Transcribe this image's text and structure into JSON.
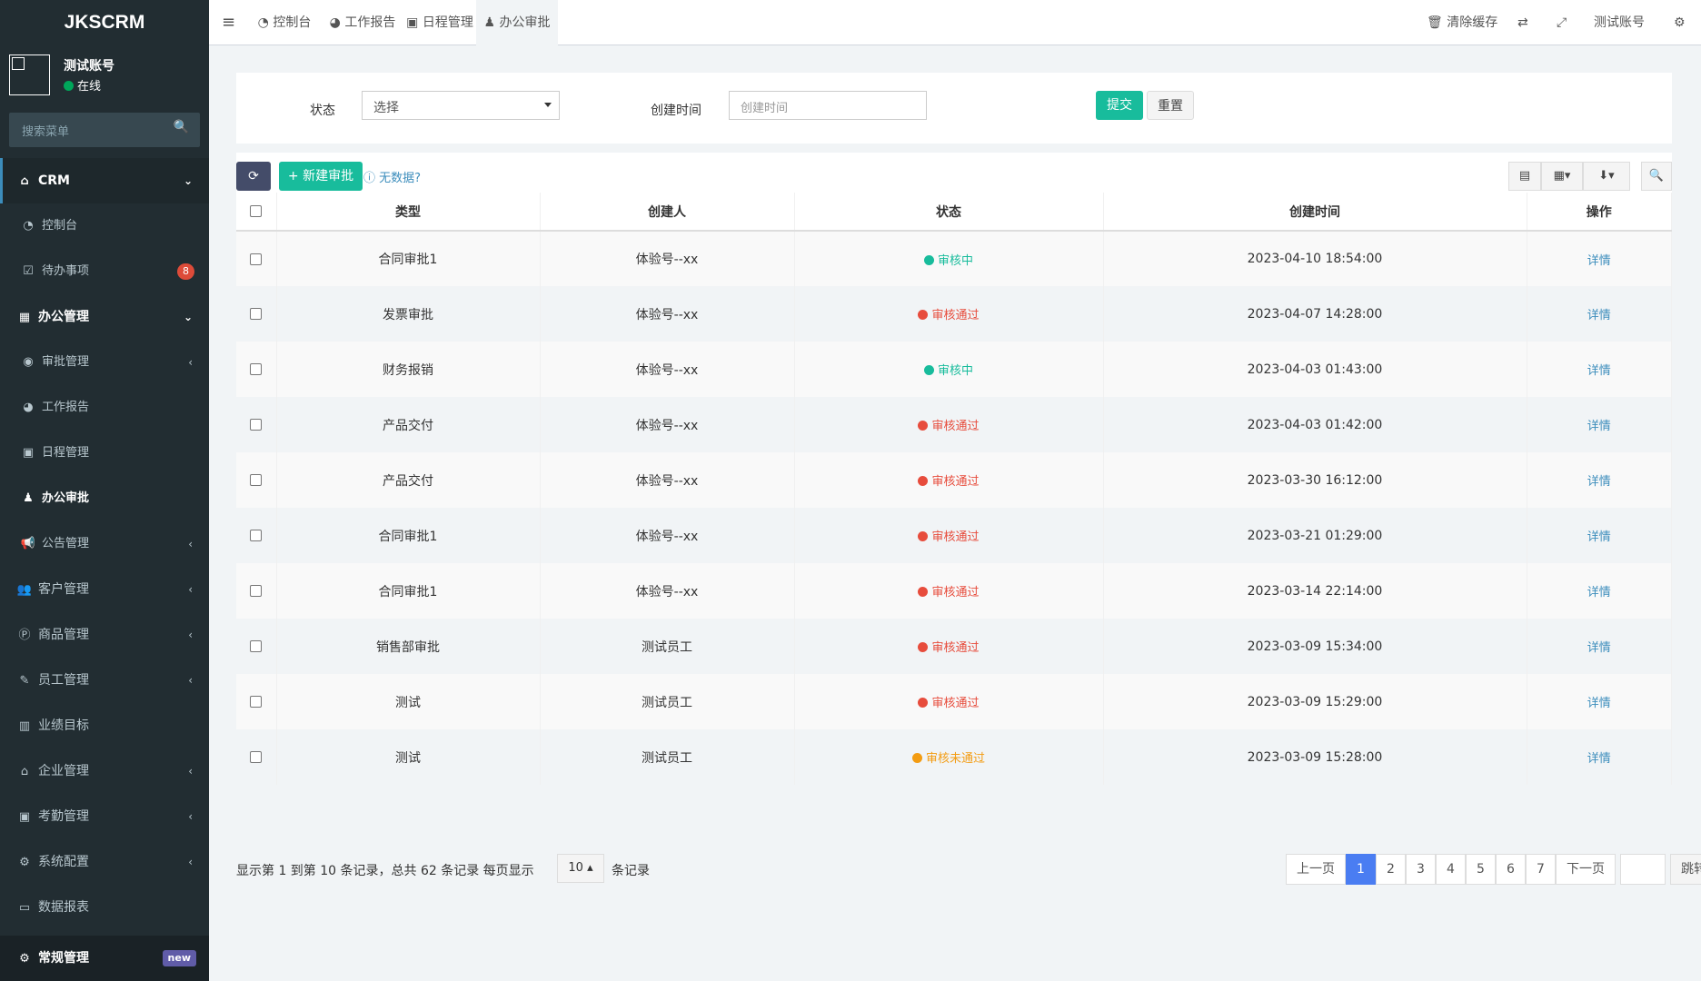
{
  "app": {
    "logo": "JKSCRM",
    "user_name": "测试账号",
    "user_status": "在线",
    "search_placeholder": "搜索菜单"
  },
  "menu": [
    {
      "label": "CRM",
      "icon": "home-icon",
      "type": "group",
      "arrow": "⌄"
    },
    {
      "label": "控制台",
      "icon": "dashboard-icon",
      "type": "sub"
    },
    {
      "label": "待办事项",
      "icon": "calendar-check-icon",
      "type": "sub",
      "badge": "8"
    },
    {
      "label": "办公管理",
      "icon": "windows-icon",
      "type": "grp2",
      "arrow": "⌄"
    },
    {
      "label": "审批管理",
      "icon": "eye-icon",
      "type": "sub",
      "arrow": "‹"
    },
    {
      "label": "工作报告",
      "icon": "pie-icon",
      "type": "sub"
    },
    {
      "label": "日程管理",
      "icon": "calendar-icon",
      "type": "sub"
    },
    {
      "label": "办公审批",
      "icon": "user-icon",
      "type": "active"
    },
    {
      "label": "公告管理",
      "icon": "bullhorn-icon",
      "type": "sub",
      "arrow": "‹"
    },
    {
      "label": "客户管理",
      "icon": "users-icon",
      "type": "main",
      "arrow": "‹"
    },
    {
      "label": "商品管理",
      "icon": "product-icon",
      "type": "main",
      "arrow": "‹"
    },
    {
      "label": "员工管理",
      "icon": "brush-icon",
      "type": "main",
      "arrow": "‹"
    },
    {
      "label": "业绩目标",
      "icon": "bar-chart-icon",
      "type": "main"
    },
    {
      "label": "企业管理",
      "icon": "bank-icon",
      "type": "main",
      "arrow": "‹"
    },
    {
      "label": "考勤管理",
      "icon": "calendar-icon",
      "type": "main",
      "arrow": "‹"
    },
    {
      "label": "系统配置",
      "icon": "gear-icon",
      "type": "main",
      "arrow": "‹"
    },
    {
      "label": "数据报表",
      "icon": "laptop-icon",
      "type": "main"
    }
  ],
  "bottom_menu": {
    "label": "常规管理",
    "badge": "new"
  },
  "topbar": {
    "tabs": [
      {
        "label": "控制台",
        "icon": "dashboard-icon"
      },
      {
        "label": "工作报告",
        "icon": "pie-icon"
      },
      {
        "label": "日程管理",
        "icon": "calendar-icon"
      },
      {
        "label": "办公审批",
        "icon": "user-icon"
      }
    ],
    "clear_cache": "清除缓存",
    "account": "测试账号"
  },
  "filter": {
    "status_label": "状态",
    "status_value": "选择",
    "created_label": "创建时间",
    "created_placeholder": "创建时间",
    "submit": "提交",
    "reset": "重置"
  },
  "toolbar": {
    "new_label": "新建审批",
    "nodata": "无数据?"
  },
  "table": {
    "headers": [
      "类型",
      "创建人",
      "状态",
      "创建时间",
      "操作"
    ],
    "rows": [
      {
        "type": "合同审批1",
        "creator": "体验号--xx",
        "status": "审核中",
        "status_color": "#18bc9c",
        "time": "2023-04-10 18:54:00",
        "action": "详情"
      },
      {
        "type": "发票审批",
        "creator": "体验号--xx",
        "status": "审核通过",
        "status_color": "#e74c3c",
        "time": "2023-04-07 14:28:00",
        "action": "详情"
      },
      {
        "type": "财务报销",
        "creator": "体验号--xx",
        "status": "审核中",
        "status_color": "#18bc9c",
        "time": "2023-04-03 01:43:00",
        "action": "详情"
      },
      {
        "type": "产品交付",
        "creator": "体验号--xx",
        "status": "审核通过",
        "status_color": "#e74c3c",
        "time": "2023-04-03 01:42:00",
        "action": "详情"
      },
      {
        "type": "产品交付",
        "creator": "体验号--xx",
        "status": "审核通过",
        "status_color": "#e74c3c",
        "time": "2023-03-30 16:12:00",
        "action": "详情"
      },
      {
        "type": "合同审批1",
        "creator": "体验号--xx",
        "status": "审核通过",
        "status_color": "#e74c3c",
        "time": "2023-03-21 01:29:00",
        "action": "详情"
      },
      {
        "type": "合同审批1",
        "creator": "体验号--xx",
        "status": "审核通过",
        "status_color": "#e74c3c",
        "time": "2023-03-14 22:14:00",
        "action": "详情"
      },
      {
        "type": "销售部审批",
        "creator": "测试员工",
        "status": "审核通过",
        "status_color": "#e74c3c",
        "time": "2023-03-09 15:34:00",
        "action": "详情"
      },
      {
        "type": "测试",
        "creator": "测试员工",
        "status": "审核通过",
        "status_color": "#e74c3c",
        "time": "2023-03-09 15:29:00",
        "action": "详情"
      },
      {
        "type": "测试",
        "creator": "测试员工",
        "status": "审核未通过",
        "status_color": "#f39c12",
        "time": "2023-03-09 15:28:00",
        "action": "详情"
      }
    ]
  },
  "footer": {
    "summary": "显示第 1 到第 10 条记录，总共 62 条记录 每页显示",
    "per_page": "10",
    "suffix": "条记录",
    "prev": "上一页",
    "pages": [
      "1",
      "2",
      "3",
      "4",
      "5",
      "6",
      "7"
    ],
    "current": "1",
    "next": "下一页",
    "jump": "跳转"
  }
}
